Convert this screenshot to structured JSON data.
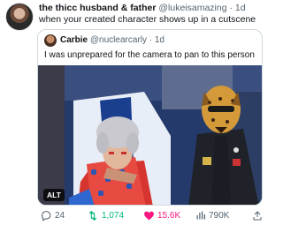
{
  "tweet": {
    "display_name": "the thicc husband & father",
    "handle": "@lukeisamazing",
    "time": "· 1d",
    "text": "when your created character shows up in a cutscene"
  },
  "quoted": {
    "display_name": "Carbie",
    "handle": "@nuclearcarly",
    "time": "· 1d",
    "text": "I was unprepared for the camera to pan to this person",
    "media_badge": "ALT"
  },
  "actions": {
    "replies": "24",
    "retweets": "1,074",
    "likes": "15.6K",
    "views": "790K"
  },
  "colors": {
    "retweet": "#00ba7c",
    "like": "#f91880",
    "muted": "#536471"
  }
}
